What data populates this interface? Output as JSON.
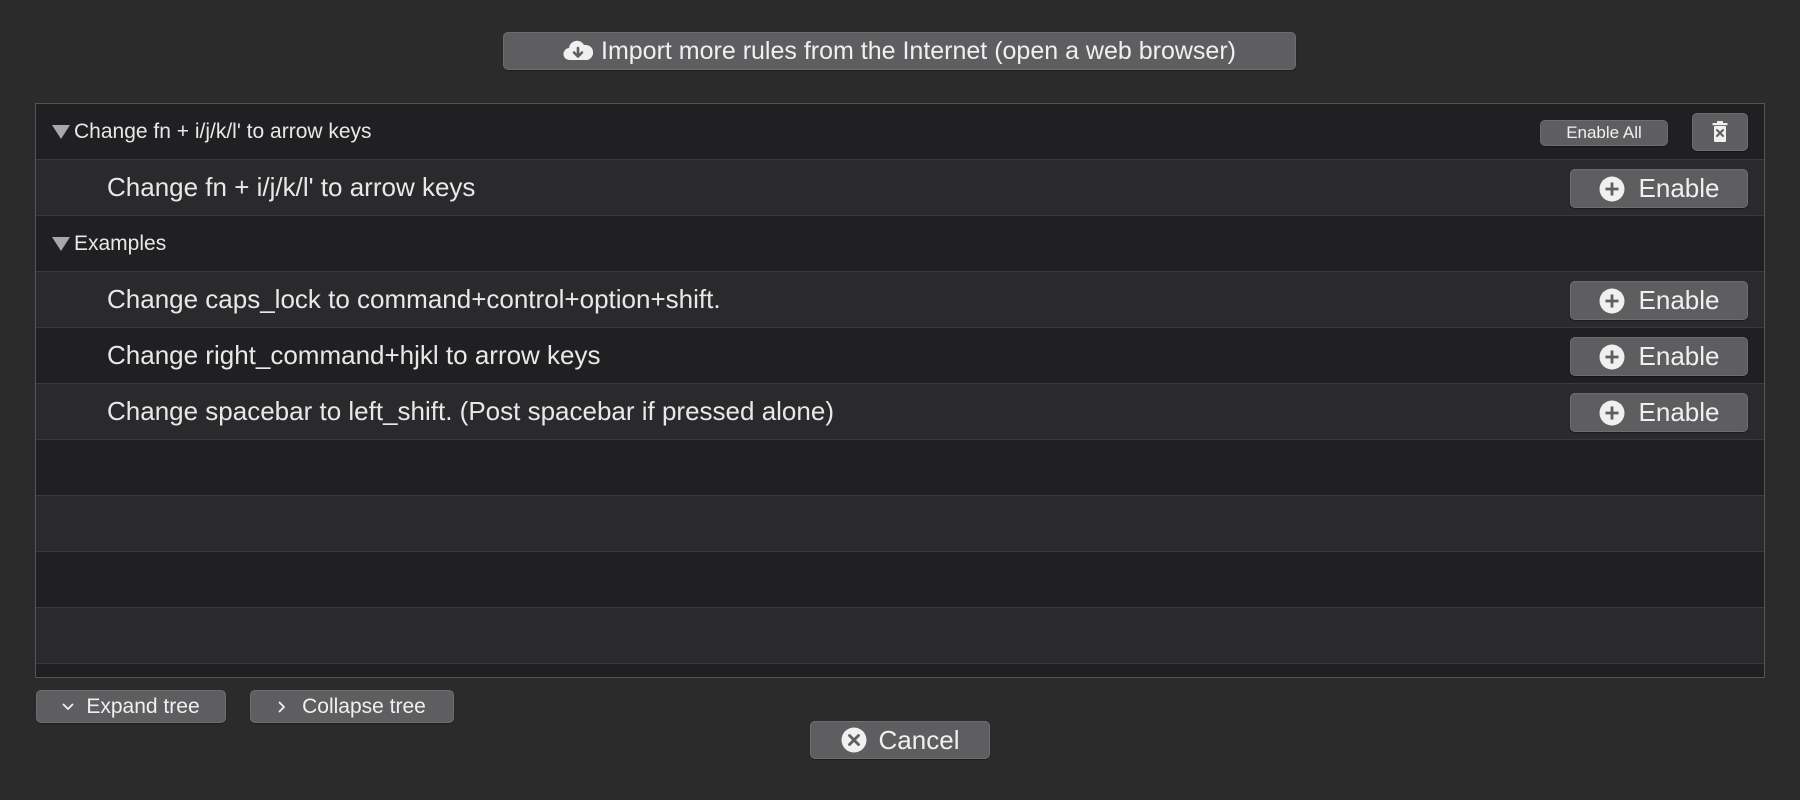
{
  "import_button": {
    "label": "Import more rules from the Internet (open a web browser)",
    "icon": "cloud-download-icon"
  },
  "groups": [
    {
      "title": "Change fn + i/j/k/l' to arrow keys",
      "enable_all_label": "Enable All",
      "rules": [
        {
          "label": "Change fn + i/j/k/l' to arrow keys",
          "button_label": "Enable"
        }
      ]
    },
    {
      "title": "Examples",
      "rules": [
        {
          "label": "Change caps_lock to command+control+option+shift.",
          "button_label": "Enable"
        },
        {
          "label": "Change right_command+hjkl to arrow keys",
          "button_label": "Enable"
        },
        {
          "label": "Change spacebar to left_shift. (Post spacebar if pressed alone)",
          "button_label": "Enable"
        }
      ]
    }
  ],
  "footer": {
    "expand_label": "Expand tree",
    "collapse_label": "Collapse tree",
    "cancel_label": "Cancel"
  },
  "colors": {
    "background": "#2b2b2c",
    "button": "#5e5e60",
    "row_odd": "#2a2a2c",
    "row_even": "#202022"
  }
}
